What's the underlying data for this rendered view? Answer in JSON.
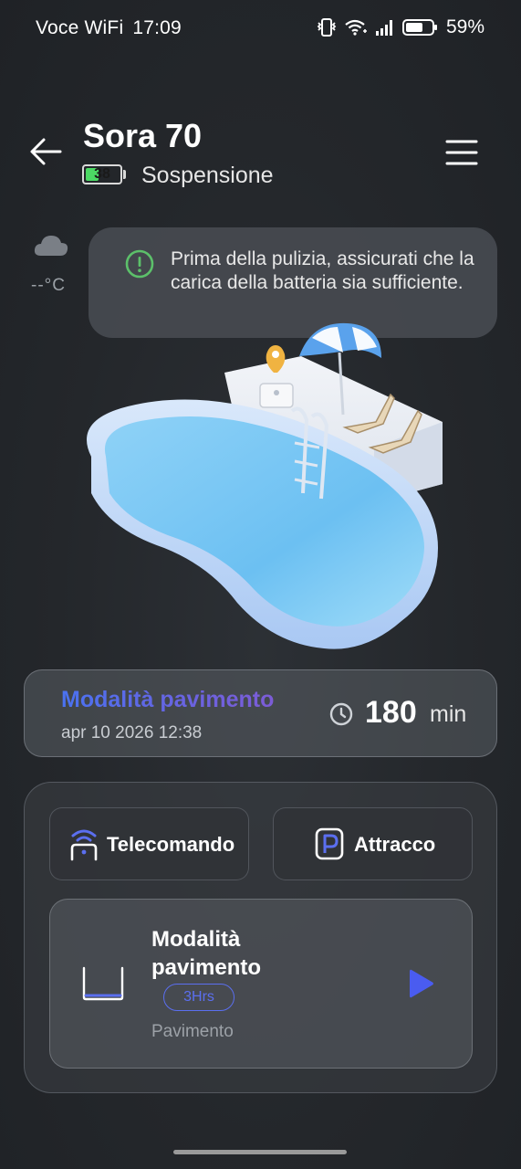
{
  "status_bar": {
    "carrier": "Voce WiFi",
    "time": "17:09",
    "battery_percent": "59%",
    "icons": [
      "vibrate-icon",
      "wifi-calling-icon",
      "signal-icon",
      "battery-icon"
    ]
  },
  "header": {
    "device_name": "Sora 70",
    "battery_level": "38",
    "battery_fraction": 0.38,
    "state": "Sospensione",
    "icons": {
      "back": "arrow-left-icon",
      "menu": "hamburger-menu-icon"
    }
  },
  "weather": {
    "icon": "cloud-icon",
    "temperature": "--°C"
  },
  "tip": {
    "icon": "exclamation-circle-icon",
    "text": "Prima della pulizia, assicurati che la carica della batteria sia sufficiente.",
    "accent_color": "#5cc06a"
  },
  "illustration": {
    "subject": "pool-with-robot-illustration"
  },
  "task": {
    "mode": "Modalità pavimento",
    "datetime": "apr 10 2026 12:38",
    "duration_value": "180",
    "duration_unit": "min",
    "icon": "clock-icon"
  },
  "controls": {
    "remote_label": "Telecomando",
    "remote_icon": "remote-control-icon",
    "dock_label": "Attracco",
    "dock_icon": "parking-dock-icon",
    "accent_color": "#5b6ff0"
  },
  "mode_card": {
    "title": "Modalità pavimento",
    "duration_pill": "3Hrs",
    "subtitle": "Pavimento",
    "icon": "floor-mode-icon",
    "play_icon": "play-icon",
    "accent_color": "#4a5cf0"
  }
}
